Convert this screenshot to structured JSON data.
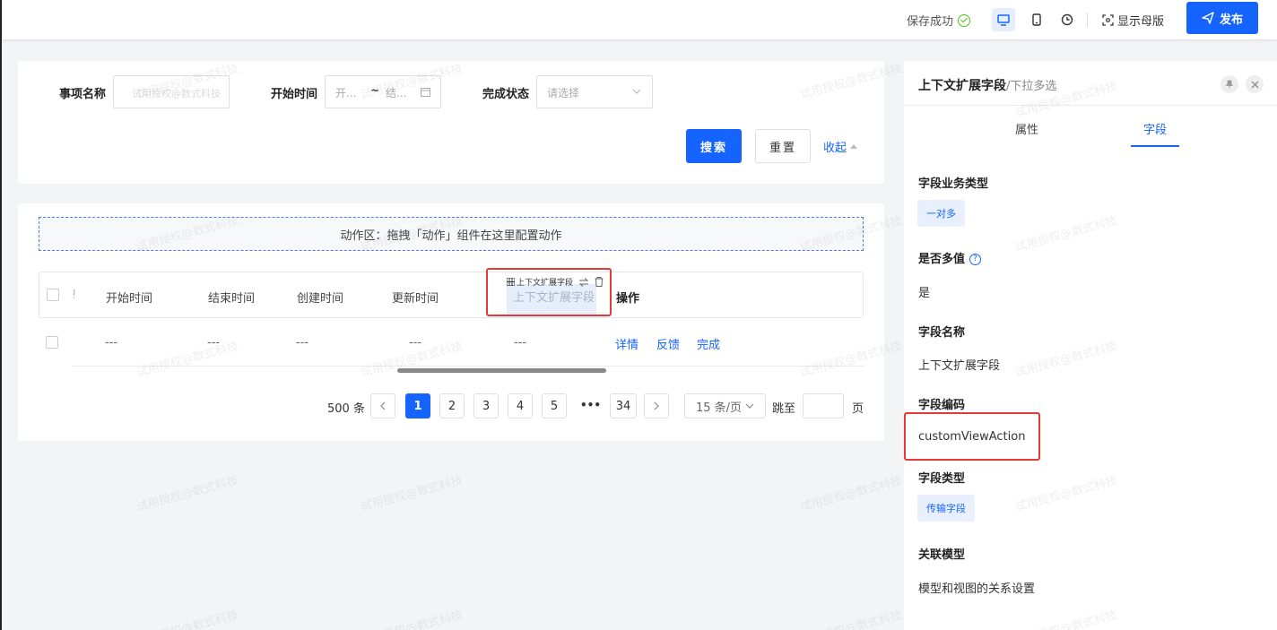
{
  "topbar": {
    "save_status": "保存成功",
    "show_master": "显示母版",
    "publish": "发布"
  },
  "search_form": {
    "item_name_label": "事项名称",
    "item_name_placeholder": "试用授权@数式科技",
    "start_time_label": "开始时间",
    "start_placeholder": "开...",
    "end_placeholder": "结...",
    "range_sep": "~",
    "status_label": "完成状态",
    "status_placeholder": "请选择",
    "search_button": "搜索",
    "reset_button": "重置",
    "collapse_link": "收起"
  },
  "table": {
    "action_zone": "动作区：拖拽「动作」组件在这里配置动作",
    "columns": {
      "c1": "开始时间",
      "c2": "结束时间",
      "c3": "创建时间",
      "c4": "更新时间",
      "c5": "上下文扩展字段",
      "c6": "操作"
    },
    "header_mark": "!",
    "selected_column_tag": "上下文扩展字段",
    "row": {
      "c1": "---",
      "c2": "---",
      "c3": "---",
      "c4": "---",
      "c5": "---",
      "action_detail": "详情",
      "action_feedback": "反馈",
      "action_done": "完成"
    }
  },
  "pagination": {
    "total": "500 条",
    "pages": [
      "1",
      "2",
      "3",
      "4",
      "5"
    ],
    "ellipsis": "•••",
    "last_page": "34",
    "page_size": "15 条/页",
    "jump_label": "跳至",
    "page_suffix": "页",
    "current_page": 1
  },
  "panel": {
    "title": "上下文扩展字段",
    "title_sub": "/下拉多选",
    "tab_props": "属性",
    "tab_field": "字段",
    "biz_type_label": "字段业务类型",
    "biz_type_value": "一对多",
    "multi_label": "是否多值",
    "multi_help": "?",
    "multi_value": "是",
    "name_label": "字段名称",
    "name_value": "上下文扩展字段",
    "code_label": "字段编码",
    "code_value": "customViewAction",
    "type_label": "字段类型",
    "type_value": "传输字段",
    "model_label": "关联模型",
    "model_value": "模型和视图的关系设置"
  },
  "watermark": "试用授权@数式科技",
  "colors": {
    "primary": "#1664ff",
    "highlight": "#e53935",
    "success": "#52c41a"
  }
}
